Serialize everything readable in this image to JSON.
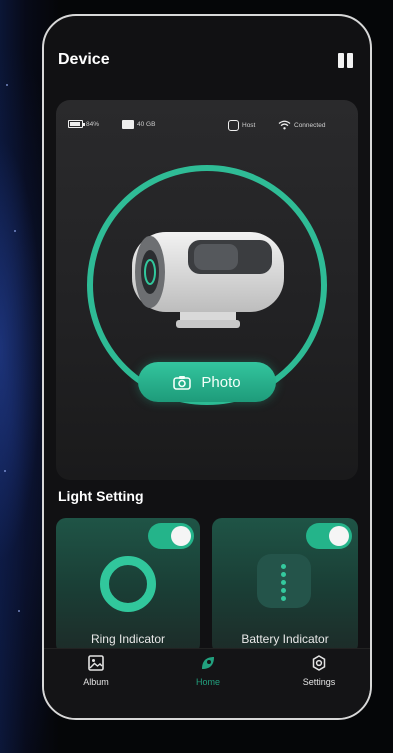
{
  "header": {
    "title": "Device"
  },
  "status": {
    "battery": "84%",
    "storage": "40 GB",
    "role": "Host",
    "connection": "Connected"
  },
  "photo_button": {
    "label": "Photo"
  },
  "light_setting": {
    "title": "Light Setting",
    "cards": [
      {
        "label": "Ring Indicator",
        "enabled": true
      },
      {
        "label": "Battery Indicator",
        "enabled": true
      }
    ]
  },
  "tabs": [
    {
      "label": "Album",
      "icon": "album-icon"
    },
    {
      "label": "Home",
      "icon": "home-icon",
      "active": true
    },
    {
      "label": "Settings",
      "icon": "settings-icon"
    }
  ],
  "colors": {
    "accent": "#2fc49c",
    "card": "#262628",
    "background": "#111113"
  }
}
